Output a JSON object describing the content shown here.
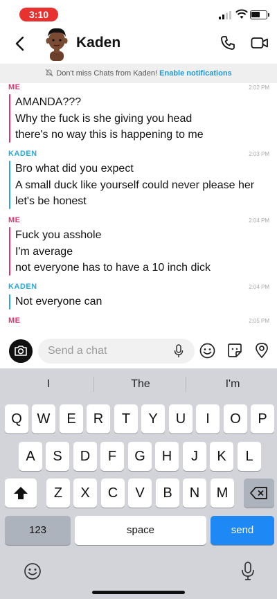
{
  "status_bar": {
    "time": "3:10",
    "battery_level": 0.6
  },
  "header": {
    "contact_name": "Kaden"
  },
  "banner": {
    "text": "Don't miss Chats from Kaden!",
    "link": "Enable notifications"
  },
  "messages": [
    {
      "sender": "ME",
      "time": "2:02 PM",
      "lines": [
        "AMANDA???",
        "Why the fuck is she giving you head",
        "there's no way this is happening to me"
      ]
    },
    {
      "sender": "KADEN",
      "time": "2:03 PM",
      "lines": [
        "Bro what did you expect",
        "A small duck like yourself could never please her",
        "let's be honest"
      ]
    },
    {
      "sender": "ME",
      "time": "2:04 PM",
      "lines": [
        "Fuck you asshole",
        "I'm average",
        "not everyone has to have a 10 inch dick"
      ]
    },
    {
      "sender": "KADEN",
      "time": "2:04 PM",
      "lines": [
        "Not everyone can"
      ]
    },
    {
      "sender": "ME",
      "time": "2:05 PM",
      "lines": []
    }
  ],
  "input": {
    "placeholder": "Send a chat"
  },
  "keyboard": {
    "suggestions": [
      "I",
      "The",
      "I'm"
    ],
    "row1": [
      "Q",
      "W",
      "E",
      "R",
      "T",
      "Y",
      "U",
      "I",
      "O",
      "P"
    ],
    "row2": [
      "A",
      "S",
      "D",
      "F",
      "G",
      "H",
      "J",
      "K",
      "L"
    ],
    "row3": [
      "Z",
      "X",
      "C",
      "V",
      "B",
      "N",
      "M"
    ],
    "numbers_key": "123",
    "space_key": "space",
    "send_key": "send"
  },
  "colors": {
    "me": "#e5336e",
    "friend": "#2aa8dc",
    "send": "#1e88f5",
    "time_pill": "#e8322f"
  },
  "icons": [
    "back-icon",
    "avatar",
    "phone-icon",
    "video-icon",
    "bell-off-icon",
    "camera-icon",
    "mic-icon",
    "emoji-icon",
    "sticker-icon",
    "map-pin-icon",
    "shift-icon",
    "backspace-icon",
    "keyboard-emoji-icon",
    "dictation-mic-icon"
  ]
}
